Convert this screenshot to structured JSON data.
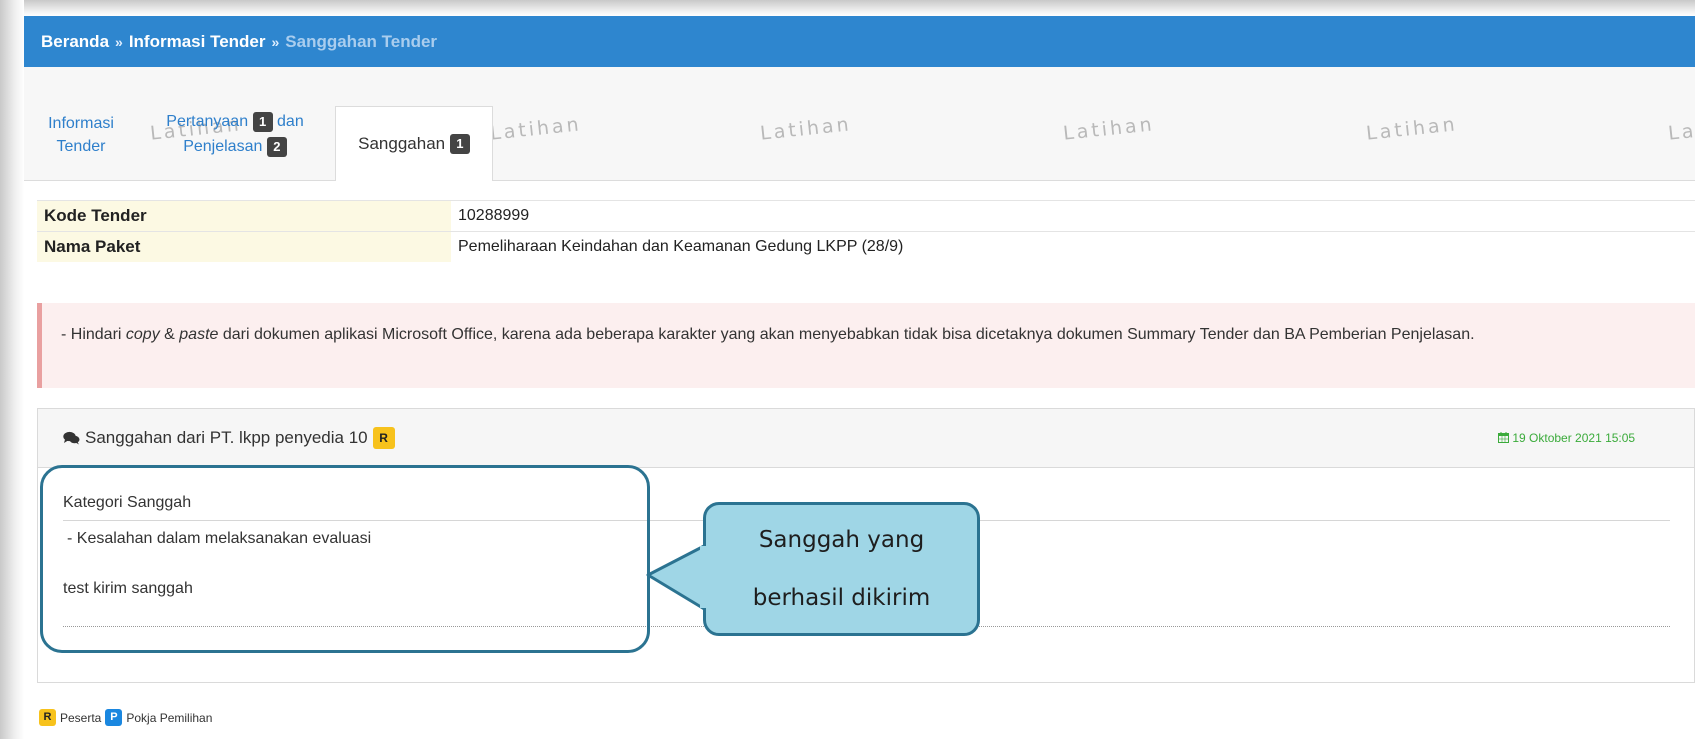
{
  "breadcrumb": {
    "items": [
      "Beranda",
      "Informasi Tender"
    ],
    "current": "Sanggahan Tender",
    "separator": "»"
  },
  "tabs": {
    "informasi": {
      "line1": "Informasi",
      "line2": "Tender"
    },
    "pertanyaan": {
      "line1": "Pertanyaan",
      "badge1": "1",
      "and": "dan",
      "line2": "Penjelasan",
      "badge2": "2"
    },
    "sanggahan": {
      "label": "Sanggahan",
      "badge": "1"
    }
  },
  "watermark": "Latihan",
  "info": [
    {
      "label": "Kode Tender",
      "value": "10288999"
    },
    {
      "label": "Nama Paket",
      "value": "Pemeliharaan Keindahan dan Keamanan Gedung LKPP (28/9)"
    }
  ],
  "alert": {
    "prefix": "- Hindari ",
    "copy": "copy",
    "amp": " & ",
    "paste": "paste",
    "rest": " dari dokumen aplikasi Microsoft Office, karena ada beberapa karakter yang akan menyebabkan tidak bisa dicetaknya dokumen Summary Tender dan BA Pemberian Penjelasan."
  },
  "sanggahan": {
    "title": "Sanggahan dari PT. lkpp penyedia 10",
    "badge": "R",
    "date": "19 Oktober 2021 15:05",
    "kategori_label": "Kategori Sanggah",
    "kategori_item": "-  Kesalahan dalam melaksanakan evaluasi",
    "message": "test kirim sanggah"
  },
  "callout": {
    "line1": "Sanggah yang",
    "line2": "berhasil dikirim"
  },
  "legend": {
    "r_badge": "R",
    "r_label": "Peserta",
    "p_badge": "P",
    "p_label": "Pokja Pemilihan"
  },
  "colors": {
    "header_blue": "#2e86cf",
    "callout_fill": "#9fd6e6",
    "callout_border": "#2b7391",
    "alert_bg": "#fcefef",
    "date_green": "#3bab3b"
  }
}
